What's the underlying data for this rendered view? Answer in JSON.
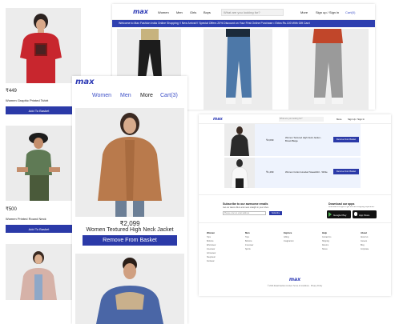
{
  "left_column": {
    "products": [
      {
        "price": "₹449",
        "name": "Women Graphic Printed Tshirt",
        "button": "Add To Basket"
      },
      {
        "price": "₹500",
        "name": "Women Printed Round Neck",
        "button": "Add To Basket"
      }
    ]
  },
  "top_window": {
    "logo": "max",
    "nav": [
      "Women",
      "Men",
      "Girls",
      "Boys"
    ],
    "search_placeholder": "What are you looking for?",
    "right_links": [
      "More",
      "Sign up / Sign in",
      "Cart(0)"
    ],
    "banner": "Welcome to Max Fashion India Online Shopping !! New Arrival !! Special Offers 20% Discount on Your First Online Purchase • Extra Rs.100 With Gift Card"
  },
  "middle_window": {
    "logo": "max",
    "nav": [
      "Women",
      "Men",
      "More",
      "Cart(3)"
    ],
    "price": "₹2,099",
    "name": "Women Textured High Neck Jacket",
    "remove_button": "Remove From Basket"
  },
  "basket_window": {
    "logo": "max",
    "search_placeholder": "What are you looking for?",
    "header_links": [
      "More",
      "Sign Up / Sign In"
    ],
    "rows": [
      {
        "price": "₹2,099",
        "name": "Women Textured High Neck Jacket - Brown/Beige",
        "button": "Remove From Basket"
      },
      {
        "price": "₹1,499",
        "name": "Women Cotton Hooded Sweatshirt - White",
        "button": "Remove From Basket"
      }
    ],
    "subscribe_title": "Subscribe to our awesome emails",
    "subscribe_text": "Get our latest offers and news straight in your inbox.",
    "email_placeholder": "Please enter an email address",
    "subscribe_button": "Subscribe",
    "app_title": "Download our apps",
    "app_text": "Download our apps to get the best shopping experience.",
    "google_play": "Google Play",
    "app_store": "App Store",
    "footer_columns": [
      {
        "title": "Women",
        "links": [
          "Tops",
          "Bottoms",
          "Ethnicwear",
          "Innerwear",
          "Activewear",
          "Sleepwear",
          "Footwear"
        ]
      },
      {
        "title": "Men",
        "links": [
          "Tops",
          "Bottoms",
          "Innerwear",
          "Sports"
        ]
      },
      {
        "title": "Explore",
        "links": [
          "Gifting",
          "Imaginarium"
        ]
      },
      {
        "title": "Help",
        "links": [
          "Contact Us",
          "Shipping",
          "Returns",
          "Stores"
        ]
      },
      {
        "title": "About",
        "links": [
          "About Us",
          "Careers",
          "Blog",
          "Corporate"
        ]
      }
    ],
    "footer_logo": "max",
    "copyright": "© 2023 Retail Fashion Limited. Terms & Conditions · Privacy Policy"
  },
  "colors": {
    "brand_blue": "#2b3aa8",
    "link_blue": "#3f51c8",
    "banner_blue": "#2e3fb0",
    "light_blue_row": "#eef3fd"
  }
}
